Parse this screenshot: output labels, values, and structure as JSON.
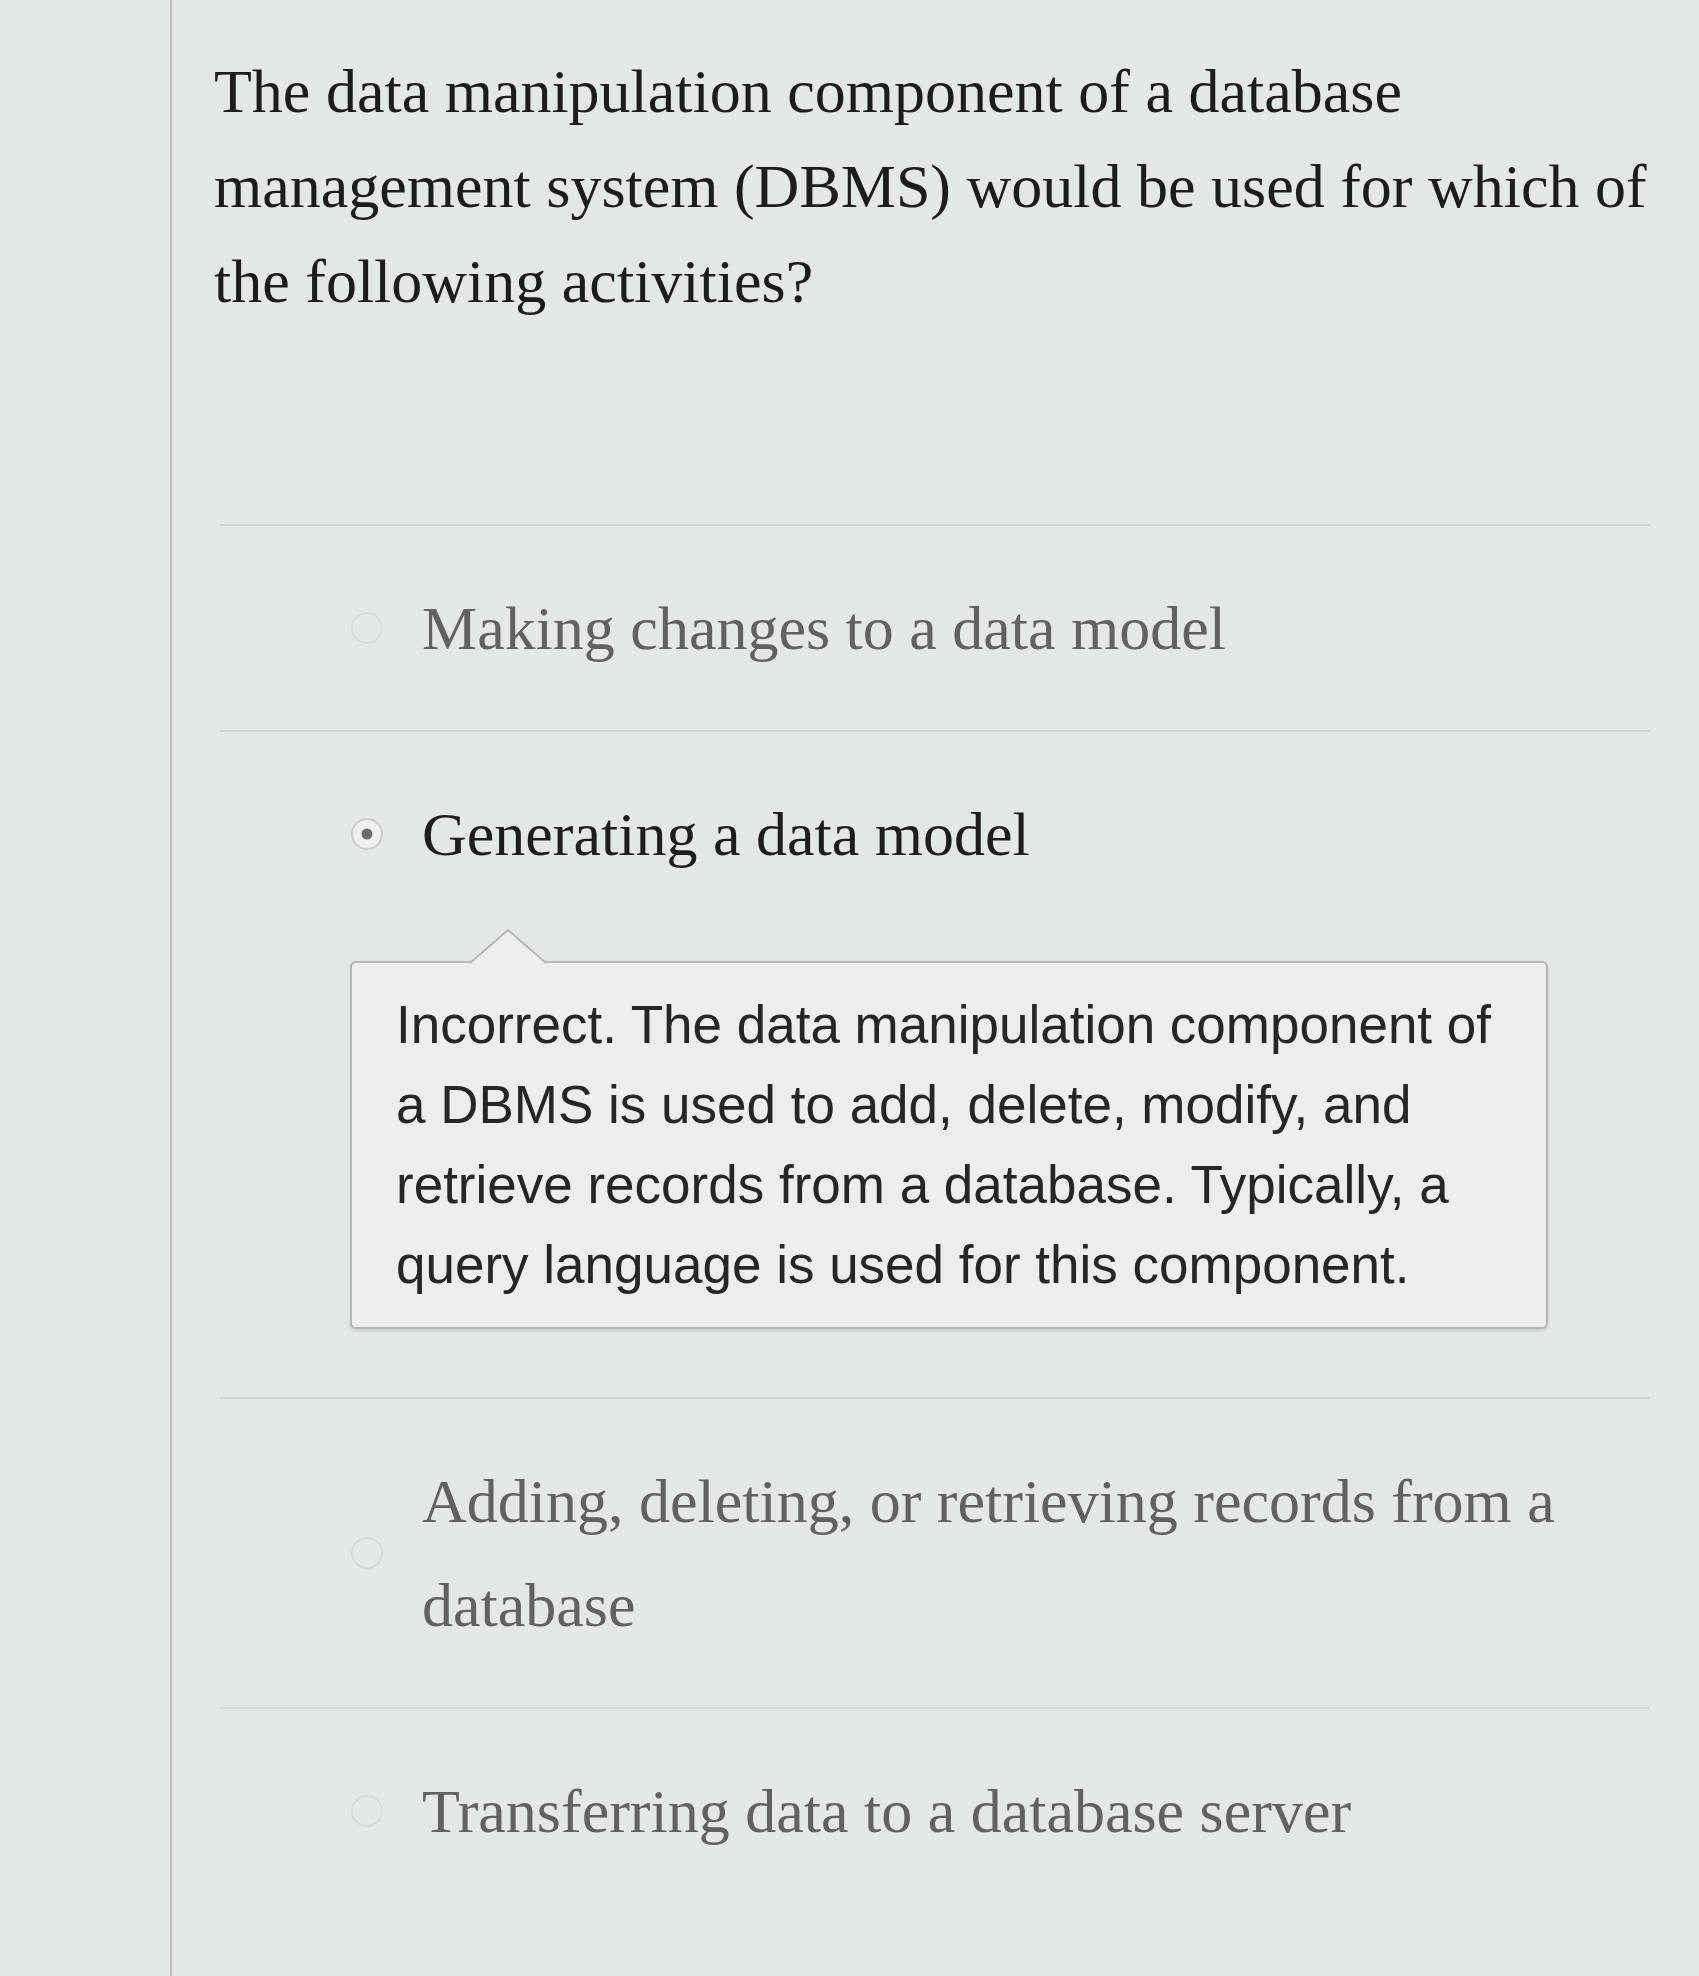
{
  "question": {
    "text": "The data manipulation component of a database management system (DBMS) would be used for which of the following activities?"
  },
  "options": [
    {
      "label": "Making changes to a data model",
      "selected": false
    },
    {
      "label": "Generating a data model",
      "selected": true,
      "feedback": "Incorrect. The data manipulation component of a DBMS is used to add, delete, modify, and retrieve records from a database. Typically, a query language is used for this component."
    },
    {
      "label": "Adding, deleting, or retrieving records from a database",
      "selected": false
    },
    {
      "label": "Transferring data to a database server",
      "selected": false
    }
  ]
}
